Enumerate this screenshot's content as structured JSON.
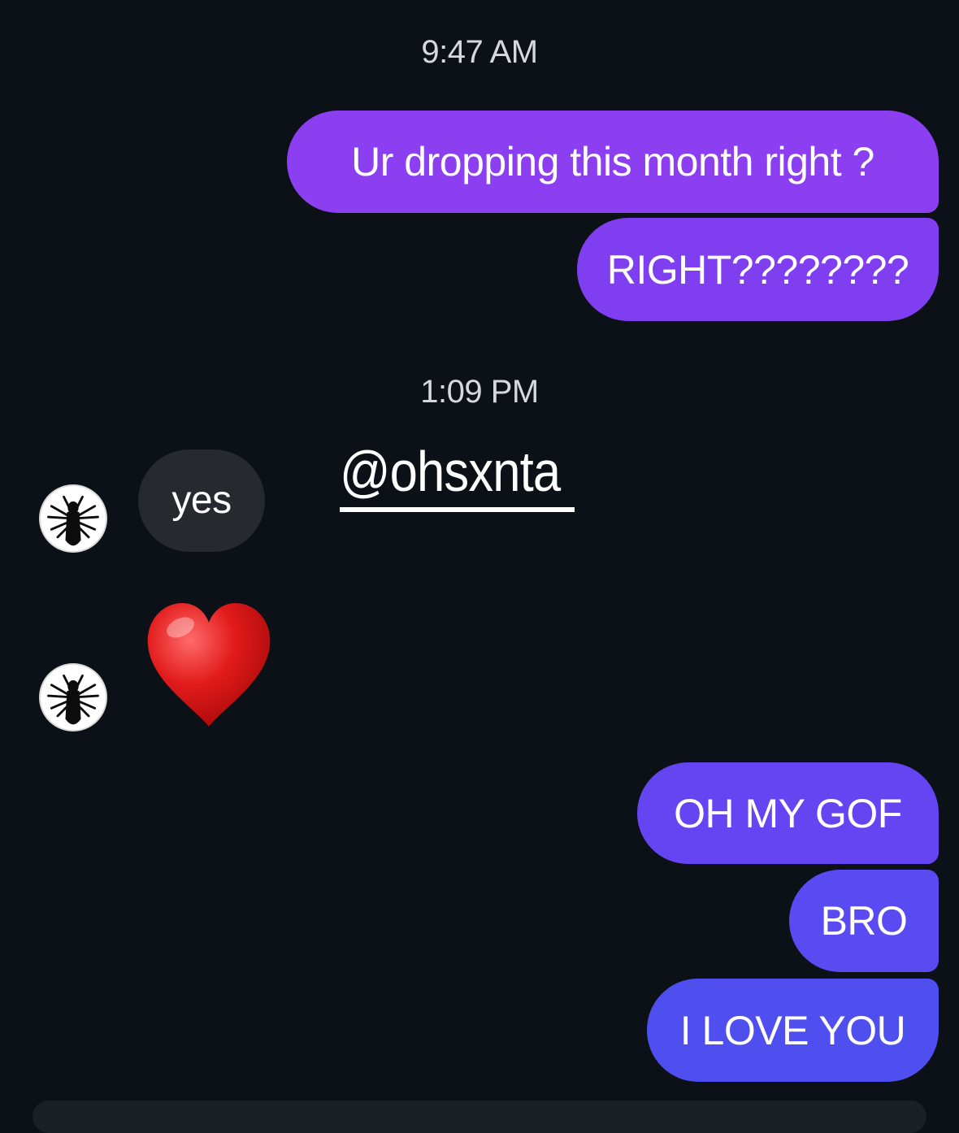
{
  "conversation": {
    "timestamps": [
      "9:47 AM",
      "1:09 PM"
    ],
    "sent_messages": [
      "Ur dropping this month right ?",
      "RIGHT????????",
      "OH MY GOF",
      "BRO",
      "I LOVE YOU"
    ],
    "received_messages": [
      "yes"
    ],
    "mention": "@ohsxnta",
    "reaction_icon": "red-heart-icon"
  },
  "colors": {
    "background": "#0c1017",
    "sent_bubble_top": "#8f3df0",
    "sent_bubble_bottom": "#4f52f0",
    "received_bubble": "#26292e"
  }
}
